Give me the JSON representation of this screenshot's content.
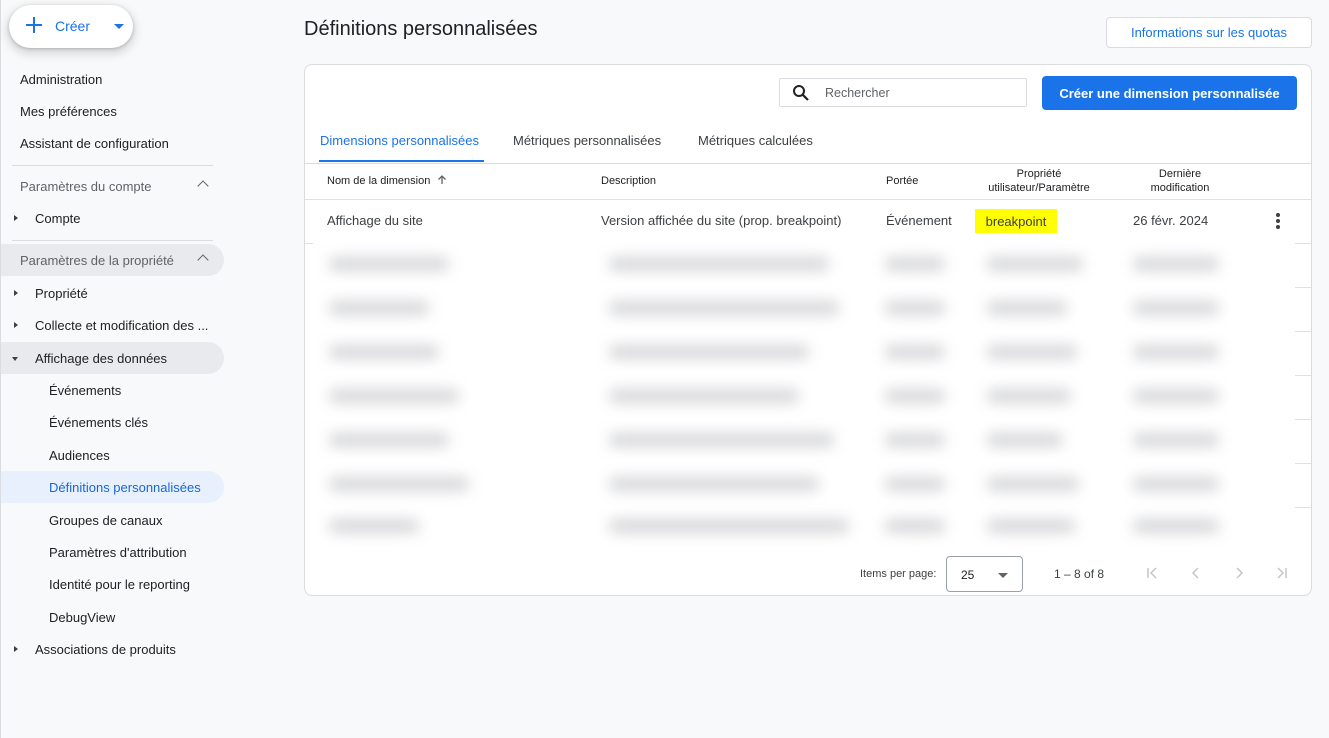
{
  "create_button": {
    "label": "Créer"
  },
  "sidebar": {
    "top_items": [
      "Administration",
      "Mes préférences",
      "Assistant de configuration"
    ],
    "account_section": {
      "title": "Paramètres du compte",
      "items": [
        "Compte"
      ]
    },
    "property_section": {
      "title": "Paramètres de la propriété",
      "items": [
        "Propriété",
        "Collecte et modification des ...",
        "Affichage des données"
      ],
      "data_display_subitems": [
        "Événements",
        "Événements clés",
        "Audiences",
        "Définitions personnalisées",
        "Groupes de canaux",
        "Paramètres d'attribution",
        "Identité pour le reporting",
        "DebugView"
      ],
      "after_items": [
        "Associations de produits"
      ]
    }
  },
  "header": {
    "title": "Définitions personnalisées",
    "quota_button": "Informations sur les quotas"
  },
  "search": {
    "placeholder": "Rechercher"
  },
  "create_dimension_button": "Créer une dimension personnalisée",
  "tabs": [
    {
      "label": "Dimensions personnalisées",
      "active": true
    },
    {
      "label": "Métriques personnalisées",
      "active": false
    },
    {
      "label": "Métriques calculées",
      "active": false
    }
  ],
  "table": {
    "columns": {
      "name": "Nom de la dimension",
      "description": "Description",
      "scope": "Portée",
      "property_line1": "Propriété",
      "property_line2": "utilisateur/Paramètre",
      "modified_line1": "Dernière",
      "modified_line2": "modification"
    },
    "rows": [
      {
        "name": "Affichage du site",
        "description": "Version affichée du site (prop. breakpoint)",
        "scope": "Événement",
        "parameter": "breakpoint",
        "modified": "26 févr. 2024"
      }
    ],
    "highlight_color": "#ffff00"
  },
  "pagination": {
    "items_per_page_label": "Items per page:",
    "items_per_page": "25",
    "range": "1 – 8 of 8"
  },
  "colors": {
    "accent": "#1a73e8",
    "active_nav_bg": "#e8f0fe"
  }
}
